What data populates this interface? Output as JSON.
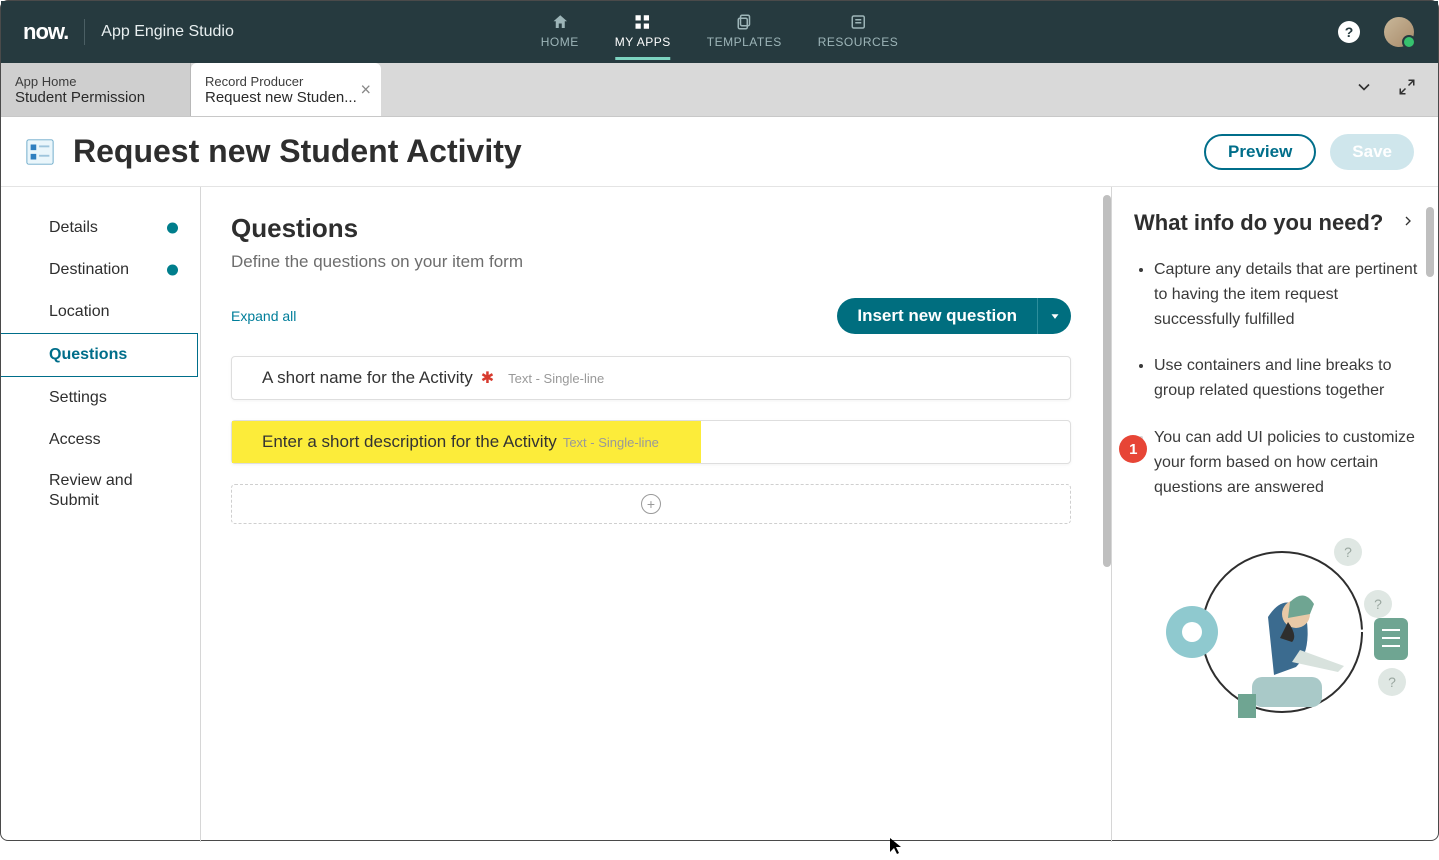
{
  "brand": {
    "logo": "now.",
    "app": "App Engine Studio"
  },
  "topnav": {
    "items": [
      {
        "label": "HOME"
      },
      {
        "label": "MY APPS"
      },
      {
        "label": "TEMPLATES"
      },
      {
        "label": "RESOURCES"
      }
    ],
    "help_glyph": "?"
  },
  "tabs": {
    "items": [
      {
        "title": "App Home",
        "subtitle": "Student Permission"
      },
      {
        "title": "Record Producer",
        "subtitle": "Request new Studen..."
      }
    ]
  },
  "page": {
    "title": "Request new Student Activity",
    "preview": "Preview",
    "save": "Save"
  },
  "sidebar": {
    "items": [
      {
        "label": "Details"
      },
      {
        "label": "Destination"
      },
      {
        "label": "Location"
      },
      {
        "label": "Questions"
      },
      {
        "label": "Settings"
      },
      {
        "label": "Access"
      },
      {
        "label": "Review and Submit"
      }
    ]
  },
  "questions": {
    "title": "Questions",
    "subtitle": "Define the questions on your item form",
    "expand": "Expand all",
    "insert": "Insert new question",
    "cards": [
      {
        "label": "A short name for the Activity",
        "required": true,
        "type": "Text - Single-line"
      },
      {
        "label": "Enter a short description for the Activity",
        "required": false,
        "type": "Text - Single-line"
      }
    ],
    "callout": "1"
  },
  "help": {
    "title": "What info do you need?",
    "bullets": [
      "Capture any details that are pertinent to having the item request successfully fulfilled",
      "Use containers and line breaks to group related questions together",
      "You can add UI policies to customize your form based on how certain questions are answered"
    ]
  }
}
